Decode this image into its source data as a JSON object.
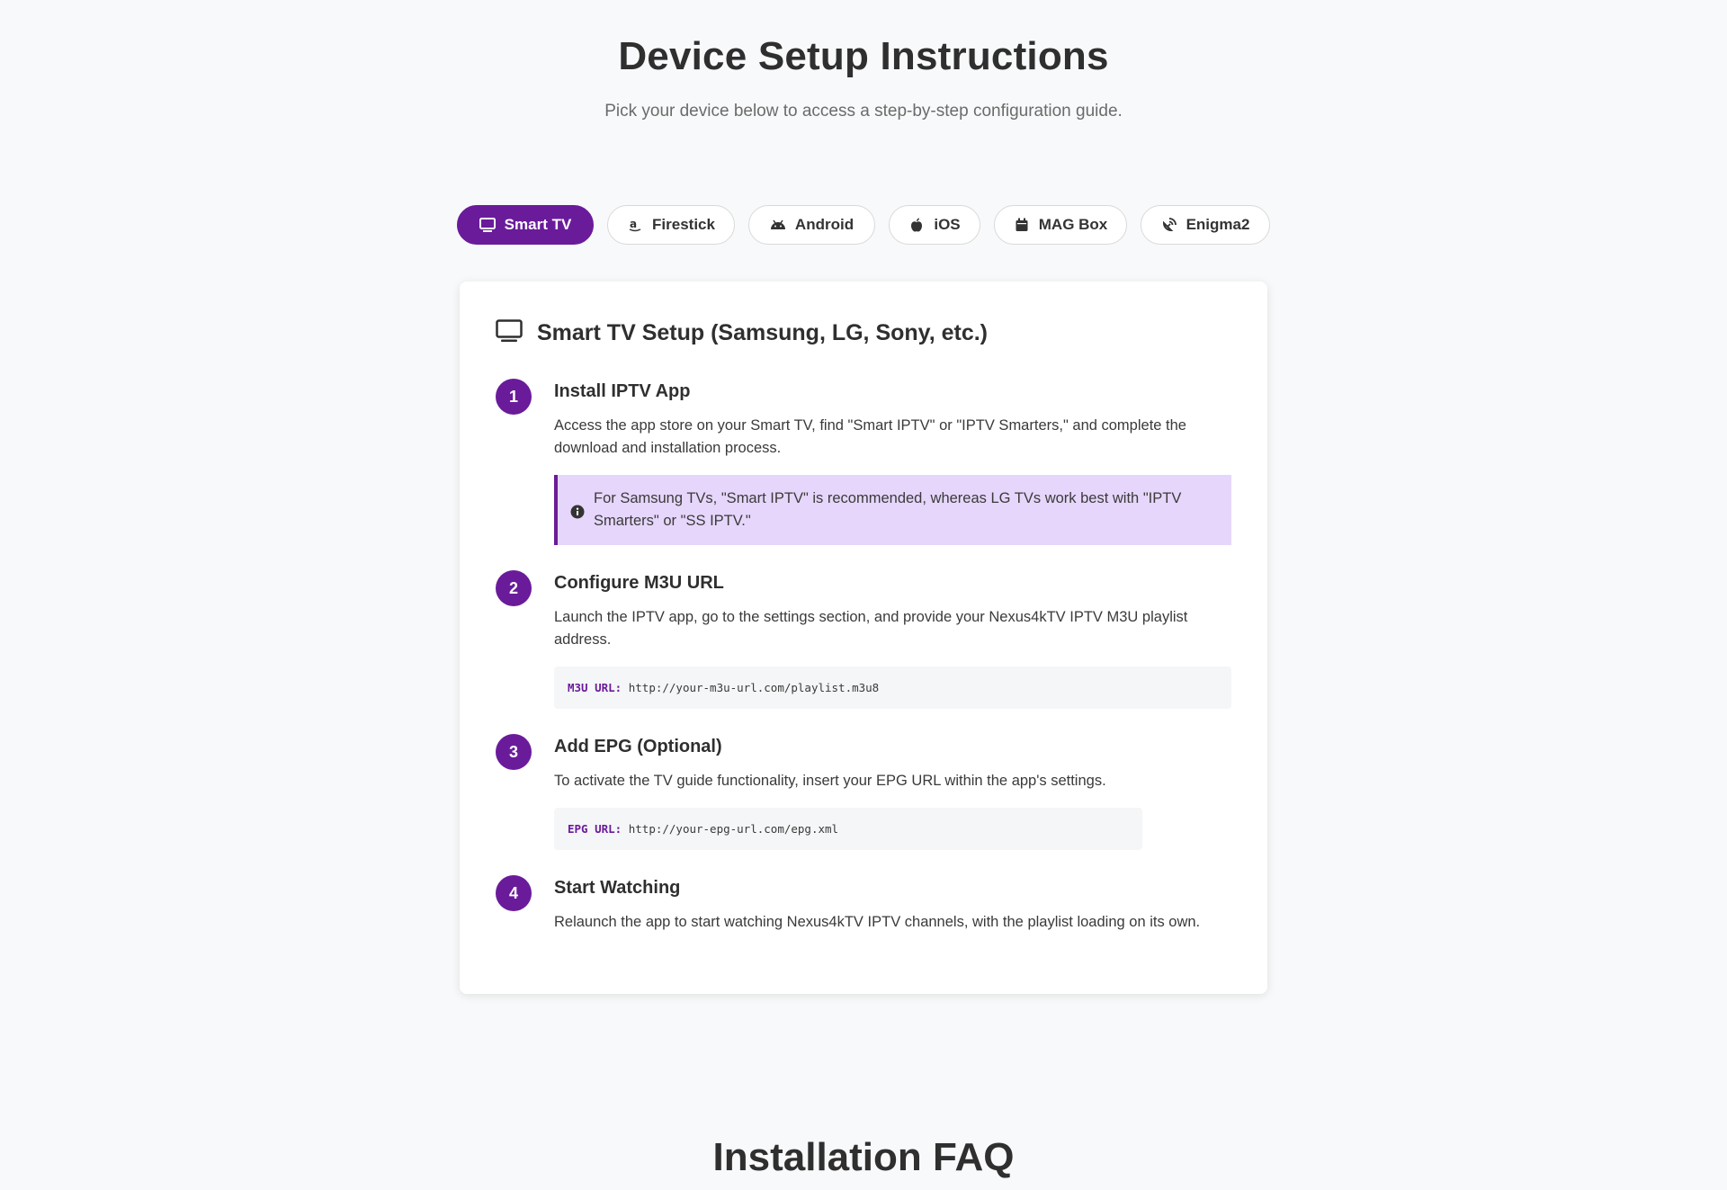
{
  "hero": {
    "title": "Device Setup Instructions",
    "subtitle": "Pick your device below to access a step-by-step configuration guide."
  },
  "tabs": [
    {
      "label": "Smart TV",
      "icon": "tv-icon",
      "active": true
    },
    {
      "label": "Firestick",
      "icon": "amazon-icon",
      "active": false
    },
    {
      "label": "Android",
      "icon": "android-icon",
      "active": false
    },
    {
      "label": "iOS",
      "icon": "apple-icon",
      "active": false
    },
    {
      "label": "MAG Box",
      "icon": "box-icon",
      "active": false
    },
    {
      "label": "Enigma2",
      "icon": "satellite-dish-icon",
      "active": false
    }
  ],
  "card": {
    "title": "Smart TV Setup (Samsung, LG, Sony, etc.)",
    "icon": "tv-icon",
    "steps": [
      {
        "number": "1",
        "title": "Install IPTV App",
        "description": "Access the app store on your Smart TV, find \"Smart IPTV\" or \"IPTV Smarters,\" and complete the download and installation process.",
        "note": "For Samsung TVs, \"Smart IPTV\" is recommended, whereas LG TVs work best with \"IPTV Smarters\" or \"SS IPTV.\""
      },
      {
        "number": "2",
        "title": "Configure M3U URL",
        "description": "Launch the IPTV app, go to the settings section, and provide your Nexus4kTV IPTV M3U playlist address.",
        "code_label": "M3U URL:",
        "code_value": "http://your-m3u-url.com/playlist.m3u8"
      },
      {
        "number": "3",
        "title": "Add EPG (Optional)",
        "description": "To activate the TV guide functionality, insert your EPG URL within the app's settings.",
        "code_label": "EPG URL:",
        "code_value": "http://your-epg-url.com/epg.xml"
      },
      {
        "number": "4",
        "title": "Start Watching",
        "description": "Relaunch the app to start watching Nexus4kTV IPTV channels, with the playlist loading on its own."
      }
    ]
  },
  "faq": {
    "title": "Installation FAQ"
  },
  "colors": {
    "accent": "#6a1b9a",
    "note_bg": "#e6d6fb",
    "page_bg": "#f8f9fa"
  }
}
